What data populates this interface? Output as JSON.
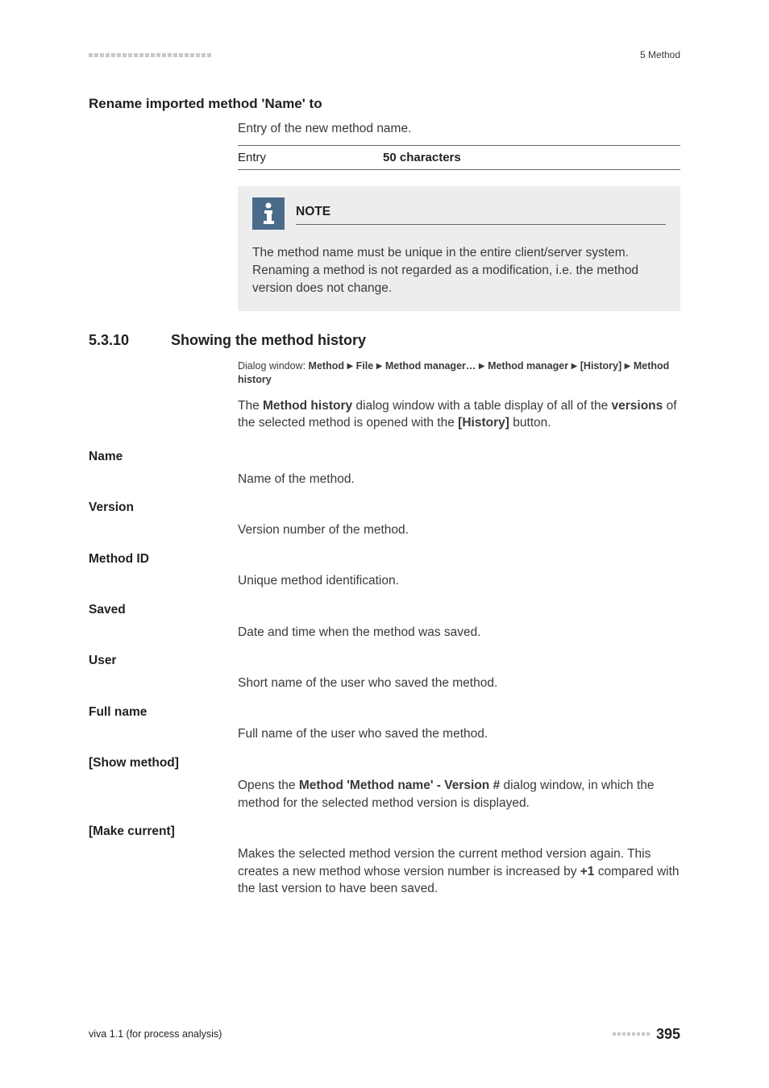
{
  "header": {
    "chapter": "5 Method"
  },
  "rename": {
    "heading": "Rename imported method 'Name' to",
    "body": "Entry of the new method name.",
    "entry_label": "Entry",
    "entry_value": "50 characters"
  },
  "note": {
    "title": "NOTE",
    "body": "The method name must be unique in the entire client/server system. Renaming a method is not regarded as a modification, i.e. the method version does not change."
  },
  "section": {
    "number": "5.3.10",
    "title": "Showing the method history",
    "path_prefix": "Dialog window: ",
    "path_parts": [
      "Method",
      "File",
      "Method manager…",
      "Method manager",
      "[History]",
      "Method history"
    ],
    "intro_pre": "The ",
    "intro_b1": "Method history",
    "intro_mid1": " dialog window with a table display of all of the ",
    "intro_b2": "versions",
    "intro_mid2": " of the selected method is opened with the ",
    "intro_b3": "[History]",
    "intro_post": " button."
  },
  "fields": {
    "name": {
      "label": "Name",
      "desc": "Name of the method."
    },
    "version": {
      "label": "Version",
      "desc": "Version number of the method."
    },
    "method_id": {
      "label": "Method ID",
      "desc": "Unique method identification."
    },
    "saved": {
      "label": "Saved",
      "desc": "Date and time when the method was saved."
    },
    "user": {
      "label": "User",
      "desc": "Short name of the user who saved the method."
    },
    "full_name": {
      "label": "Full name",
      "desc": "Full name of the user who saved the method."
    },
    "show_method": {
      "label": "[Show method]",
      "desc_pre": "Opens the ",
      "desc_b1": "Method 'Method name' - Version #",
      "desc_post": " dialog window, in which the method for the selected method version is displayed."
    },
    "make_current": {
      "label": "[Make current]",
      "desc_pre": "Makes the selected method version the current method version again. This creates a new method whose version number is increased by ",
      "desc_b1": "+1",
      "desc_post": " compared with the last version to have been saved."
    }
  },
  "footer": {
    "left": "viva 1.1 (for process analysis)",
    "page": "395"
  }
}
